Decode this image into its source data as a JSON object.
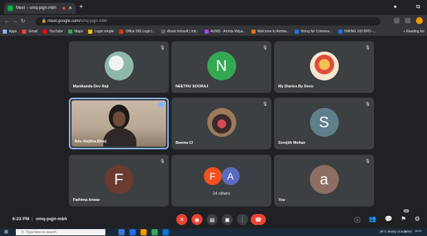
{
  "browser": {
    "tab_title": "Meet – omq-pqjn-mbh",
    "new_tab": "+",
    "url_host": "meet.google.com/",
    "url_path": "omq-pqjn-mbh",
    "bookmarks": [
      {
        "label": "Apps",
        "color": "#8ab4f8"
      },
      {
        "label": "Gmail",
        "color": "#ea4335"
      },
      {
        "label": "YouTube",
        "color": "#ff0000"
      },
      {
        "label": "Maps",
        "color": "#34a853"
      },
      {
        "label": "Login simple",
        "color": "#fbbc04"
      },
      {
        "label": "Office 365 Login |...",
        "color": "#d83b01"
      },
      {
        "label": "About Infosoft | Intr...",
        "color": "#5f6368"
      },
      {
        "label": "AUMS - Amrita Vidya...",
        "color": "#a142f4"
      },
      {
        "label": "Welcome to Amrita...",
        "color": "#e8710a"
      },
      {
        "label": "Hiring for Commse...",
        "color": "#1a73e8"
      },
      {
        "label": "HIRING 100 BPO -...",
        "color": "#1a73e8"
      }
    ],
    "bookmarks_more": "» Reading list"
  },
  "tiles": [
    {
      "name": "Manikanda Dev Raji",
      "avatar": "photo1",
      "initial": ""
    },
    {
      "name": "NEETHU SOORAJ",
      "avatar": "letter",
      "initial": "N",
      "color": "#34a853"
    },
    {
      "name": "My Diaries By Devu",
      "avatar": "photo3",
      "initial": ""
    },
    {
      "name": "Adv. Rajitha Binoj",
      "avatar": "video",
      "initial": ""
    },
    {
      "name": "Beema Cl",
      "avatar": "photo2",
      "initial": ""
    },
    {
      "name": "Sreejith Mohan",
      "avatar": "letter",
      "initial": "S",
      "color": "#5f7f8c"
    },
    {
      "name": "Fathima Anwar",
      "avatar": "letter",
      "initial": "F",
      "color": "#6a3b2e"
    },
    {
      "name": "24 others",
      "avatar": "multi",
      "initial": "",
      "multi": [
        {
          "l": "F",
          "c": "#f4511e"
        },
        {
          "l": "A",
          "c": "#5c6bc0"
        }
      ]
    },
    {
      "name": "You",
      "avatar": "letter",
      "initial": "a",
      "color": "#8d6e63"
    }
  ],
  "meeting": {
    "time": "6:23 PM",
    "separator": "|",
    "code": "omq-pqjn-mbh",
    "participants_badge": "27"
  },
  "taskbar": {
    "search_placeholder": "Type here to search",
    "weather": "29°C Mostly cloudy",
    "lang": "ENG",
    "clock": "18:23"
  }
}
